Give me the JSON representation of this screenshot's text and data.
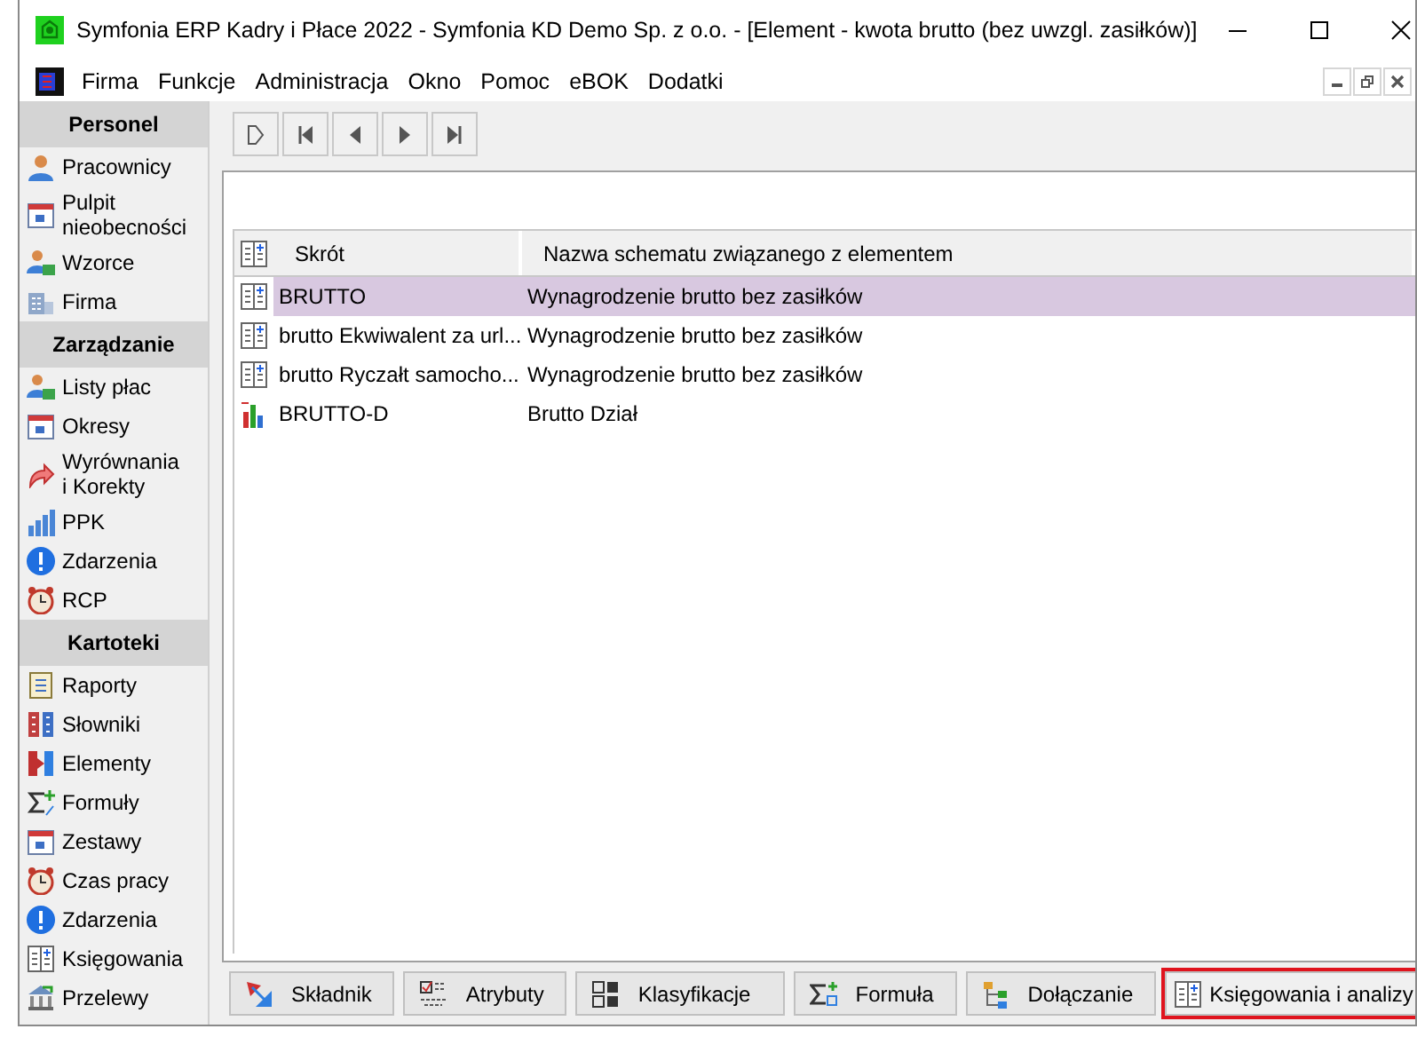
{
  "window": {
    "title": "Symfonia ERP Kadry i Płace 2022 - Symfonia KD Demo Sp. z o.o. - [Element - kwota brutto (bez uwzgl. zasiłków)]"
  },
  "menu": [
    "Firma",
    "Funkcje",
    "Administracja",
    "Okno",
    "Pomoc",
    "eBOK",
    "Dodatki"
  ],
  "sidebar": {
    "sections": [
      {
        "title": "Personel",
        "items": [
          "Pracownicy",
          "Pulpit nieobecności",
          "Wzorce",
          "Firma"
        ]
      },
      {
        "title": "Zarządzanie",
        "items": [
          "Listy płac",
          "Okresy",
          "Wyrównania\ni Korekty",
          "PPK",
          "Zdarzenia",
          "RCP"
        ]
      },
      {
        "title": "Kartoteki",
        "items": [
          "Raporty",
          "Słowniki",
          "Elementy",
          "Formuły",
          "Zestawy",
          "Czas pracy",
          "Zdarzenia",
          "Księgowania",
          "Przelewy"
        ]
      }
    ]
  },
  "table": {
    "columns": [
      "Skrót",
      "Nazwa schematu związanego z elementem"
    ],
    "rows": [
      {
        "kind": "schema",
        "short": "BRUTTO",
        "name": "Wynagrodzenie brutto bez zasiłków",
        "selected": true
      },
      {
        "kind": "schema",
        "short": "brutto Ekwiwalent za url...",
        "name": "Wynagrodzenie brutto bez zasiłków",
        "selected": false
      },
      {
        "kind": "schema",
        "short": "brutto Ryczałt samocho...",
        "name": "Wynagrodzenie brutto bez zasiłków",
        "selected": false
      },
      {
        "kind": "chart",
        "short": "BRUTTO-D",
        "name": "Brutto Dział",
        "selected": false
      }
    ]
  },
  "tabs": [
    {
      "label": "Składnik",
      "selected": false
    },
    {
      "label": "Atrybuty",
      "selected": false
    },
    {
      "label": "Klasyfikacje",
      "selected": false
    },
    {
      "label": "Formuła",
      "selected": false
    },
    {
      "label": "Dołączanie",
      "selected": false
    },
    {
      "label": "Księgowania i analizy",
      "selected": true
    }
  ]
}
